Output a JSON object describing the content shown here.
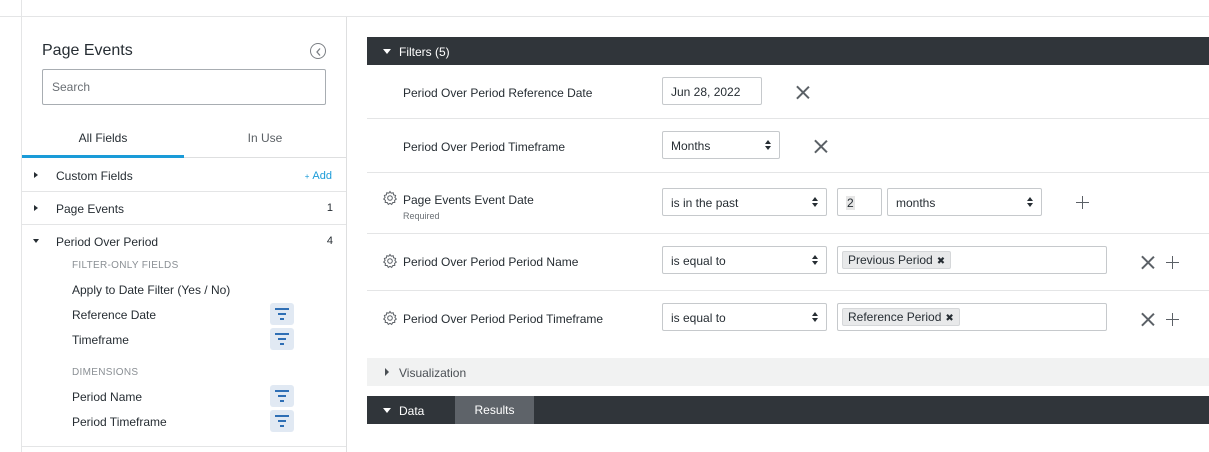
{
  "sidebar": {
    "title": "Page Events",
    "search_placeholder": "Search",
    "tabs": {
      "all": "All Fields",
      "in_use": "In Use"
    },
    "custom_fields": {
      "label": "Custom Fields",
      "add_label": "Add"
    },
    "page_events": {
      "label": "Page Events",
      "count": "1"
    },
    "period_over_period": {
      "label": "Period Over Period",
      "count": "4",
      "filter_only_header": "FILTER-ONLY FIELDS",
      "filter_only_fields": [
        "Apply to Date Filter (Yes / No)",
        "Reference Date",
        "Timeframe"
      ],
      "dimensions_header": "DIMENSIONS",
      "dimensions": [
        "Period Name",
        "Period Timeframe"
      ]
    }
  },
  "filters": {
    "header": "Filters (5)",
    "rows": [
      {
        "name": "Period Over Period Reference Date",
        "value": "Jun 28, 2022"
      },
      {
        "name": "Period Over Period Timeframe",
        "value": "Months"
      },
      {
        "name": "Page Events Event Date",
        "sub": "Required",
        "operator": "is in the past",
        "number": "2",
        "unit": "months"
      },
      {
        "name": "Period Over Period Period Name",
        "operator": "is equal to",
        "chip": "Previous Period"
      },
      {
        "name": "Period Over Period Period Timeframe",
        "operator": "is equal to",
        "chip": "Reference Period"
      }
    ]
  },
  "visualization": {
    "label": "Visualization"
  },
  "data_bar": {
    "data_label": "Data",
    "results_label": "Results"
  },
  "icons": {
    "collapse": "chevron-left-icon",
    "gear": "gear-icon",
    "filter": "filter-icon",
    "remove": "close-icon",
    "add": "plus-icon"
  },
  "colors": {
    "accent": "#1a9bd8",
    "header_bar": "#30353a",
    "results_tab": "#5e6369"
  }
}
